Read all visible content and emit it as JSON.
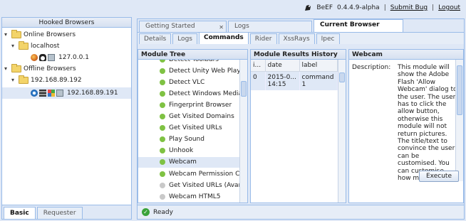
{
  "header": {
    "app_name": "BeEF",
    "version": "0.4.4.9-alpha",
    "submit_bug": "Submit Bug",
    "logout": "Logout",
    "separator": "|"
  },
  "hooked_browsers": {
    "title": "Hooked Browsers",
    "online_group": "Online Browsers",
    "online_host": "localhost",
    "online_ip": "127.0.0.1",
    "offline_group": "Offline Browsers",
    "offline_host": "192.168.89.192",
    "offline_ip": "192.168.89.191"
  },
  "left_tabs": {
    "basic": "Basic",
    "requester": "Requester"
  },
  "main_tabs": {
    "getting_started": "Getting Started",
    "logs": "Logs",
    "current_browser": "Current Browser"
  },
  "sub_tabs": [
    "Details",
    "Logs",
    "Commands",
    "Rider",
    "XssRays",
    "Ipec"
  ],
  "module_tree": {
    "title": "Module Tree",
    "items": [
      {
        "label": "Detect Toolbars",
        "color": "#7fc243"
      },
      {
        "label": "Detect Unity Web Player",
        "color": "#7fc243"
      },
      {
        "label": "Detect VLC",
        "color": "#7fc243"
      },
      {
        "label": "Detect Windows Media Pla",
        "color": "#7fc243"
      },
      {
        "label": "Fingerprint Browser",
        "color": "#7fc243"
      },
      {
        "label": "Get Visited Domains",
        "color": "#7fc243"
      },
      {
        "label": "Get Visited URLs",
        "color": "#7fc243"
      },
      {
        "label": "Play Sound",
        "color": "#7fc243"
      },
      {
        "label": "Unhook",
        "color": "#7fc243"
      },
      {
        "label": "Webcam",
        "color": "#7fc243"
      },
      {
        "label": "Webcam Permission Chec",
        "color": "#7fc243"
      },
      {
        "label": "Get Visited URLs (Avant E",
        "color": "#c9c9c9"
      },
      {
        "label": "Webcam HTML5",
        "color": "#c9c9c9"
      }
    ]
  },
  "results": {
    "title": "Module Results History",
    "columns": [
      "i...",
      "date",
      "label"
    ],
    "rows": [
      {
        "id": "0",
        "date": "2015-0... 14:15",
        "label": "command 1"
      }
    ]
  },
  "detail": {
    "title": "Webcam",
    "description_label": "Description:",
    "description": "This module will show the Adobe Flash 'Allow Webcam' dialog to the user. The user has to click the allow button, otherwise this module will not return pictures. The title/text to convince the user can be customised. You can customise how many",
    "execute": "Execute"
  },
  "status": {
    "text": "Ready"
  }
}
